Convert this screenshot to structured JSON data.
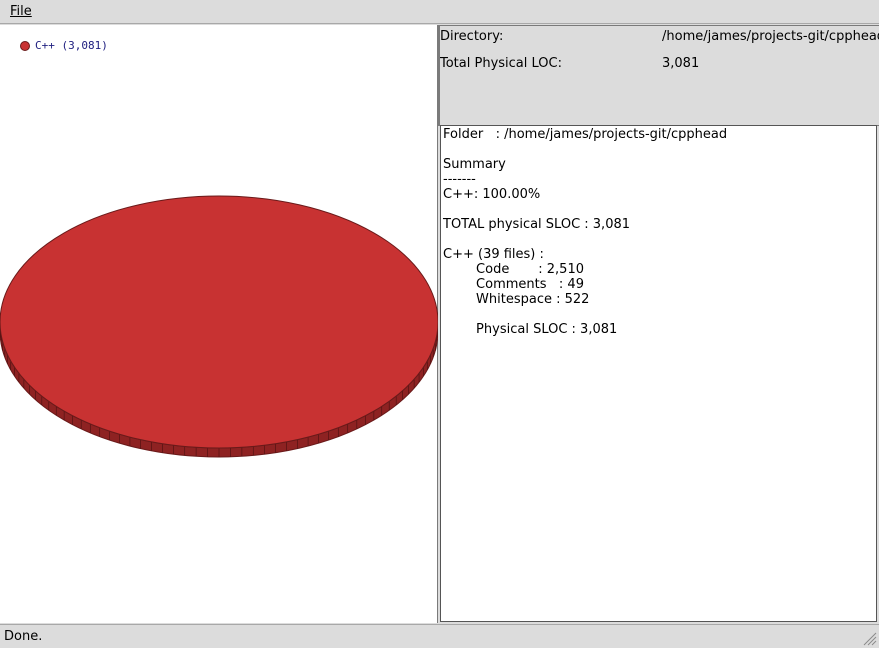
{
  "menubar": {
    "file_label": "File"
  },
  "chart": {
    "legend_label": "C++ (3,081)",
    "colors": {
      "slice": "#c83232",
      "slice_edge": "#6a1a1a",
      "legend_text": "#202080"
    }
  },
  "chart_data": {
    "type": "pie",
    "labels": [
      "C++"
    ],
    "values": [
      3081
    ],
    "legend": [
      "C++ (3,081)"
    ],
    "legend_placement": "top-left"
  },
  "info": {
    "directory_label": "Directory:",
    "directory_value": "/home/james/projects-git/cpphead",
    "loc_label": "Total Physical LOC:",
    "loc_value": "3,081"
  },
  "report": {
    "lines": [
      "Folder   : /home/james/projects-git/cpphead",
      "",
      "Summary",
      "-------",
      "C++: 100.00%",
      "",
      "TOTAL physical SLOC : 3,081",
      "",
      "C++ (39 files) :",
      "        Code       : 2,510",
      "        Comments   : 49",
      "        Whitespace : 522",
      "",
      "        Physical SLOC : 3,081"
    ]
  },
  "status": {
    "text": "Done."
  }
}
